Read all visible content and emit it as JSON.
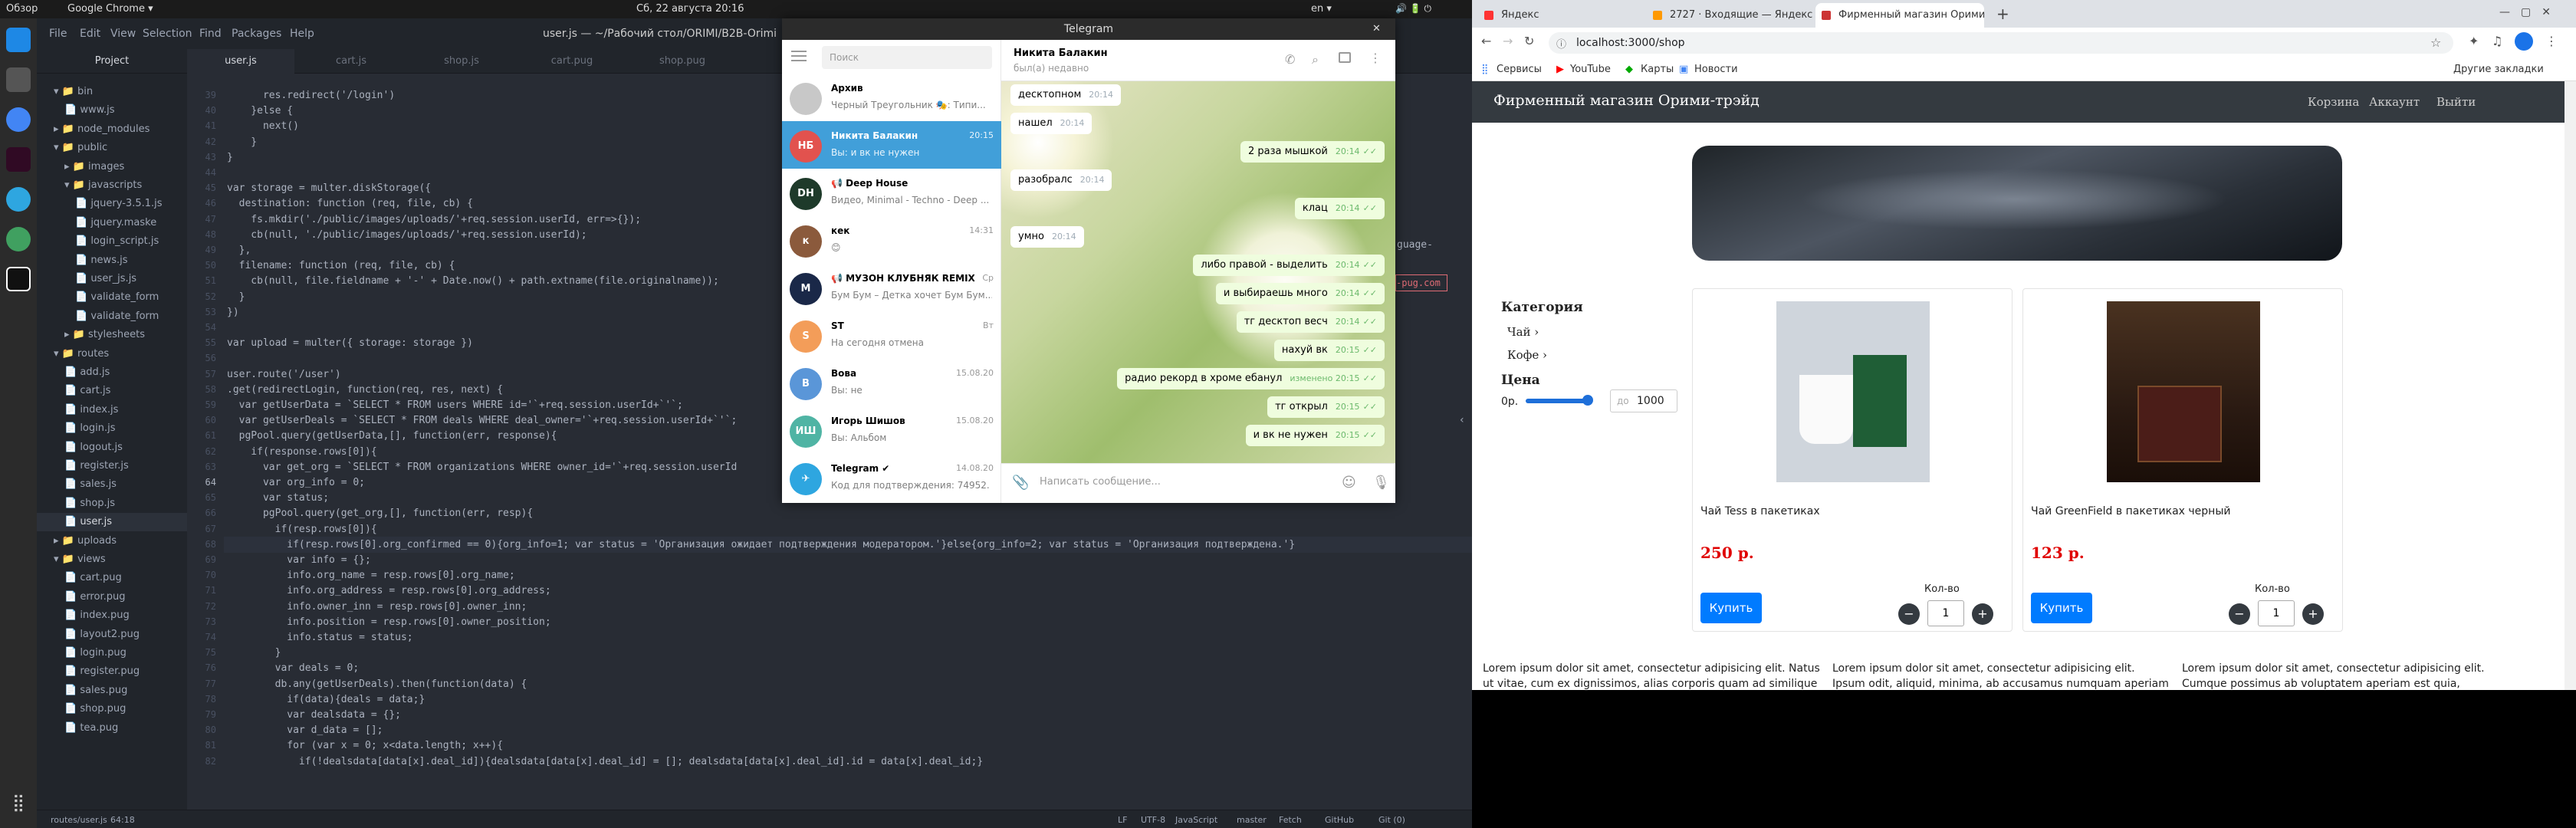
{
  "topbar": {
    "activities": "Обзор",
    "app": "Google Chrome ▾",
    "clock": "Сб, 22 августа  20:16",
    "lang": "en ▾",
    "arrow": "▾"
  },
  "atom": {
    "title": "user.js — ~/Рабочий стол/ORIMI/B2B-Orimi",
    "menu": [
      "File",
      "Edit",
      "View",
      "Selection",
      "Find",
      "Packages",
      "Help"
    ],
    "tabs": [
      "Project",
      "user.js",
      "cart.js",
      "shop.js",
      "cart.pug",
      "shop.pug"
    ],
    "tree": [
      {
        "label": "▾ 📁 bin",
        "d": 1
      },
      {
        "label": "📄 www.js",
        "d": 2
      },
      {
        "label": "▸ 📁 node_modules",
        "d": 1
      },
      {
        "label": "▾ 📁 public",
        "d": 1
      },
      {
        "label": "▸ 📁 images",
        "d": 2
      },
      {
        "label": "▾ 📁 javascripts",
        "d": 2
      },
      {
        "label": "📄 jquery-3.5.1.js",
        "d": 3
      },
      {
        "label": "📄 jquery.maske",
        "d": 3
      },
      {
        "label": "📄 login_script.js",
        "d": 3
      },
      {
        "label": "📄 news.js",
        "d": 3
      },
      {
        "label": "📄 user_js.js",
        "d": 3
      },
      {
        "label": "📄 validate_form",
        "d": 3
      },
      {
        "label": "📄 validate_form",
        "d": 3
      },
      {
        "label": "▸ 📁 stylesheets",
        "d": 2
      },
      {
        "label": "▾ 📁 routes",
        "d": 1
      },
      {
        "label": "📄 add.js",
        "d": 2
      },
      {
        "label": "📄 cart.js",
        "d": 2
      },
      {
        "label": "📄 index.js",
        "d": 2
      },
      {
        "label": "📄 login.js",
        "d": 2
      },
      {
        "label": "📄 logout.js",
        "d": 2
      },
      {
        "label": "📄 register.js",
        "d": 2
      },
      {
        "label": "📄 sales.js",
        "d": 2
      },
      {
        "label": "📄 shop.js",
        "d": 2
      },
      {
        "label": "📄 user.js",
        "d": 2
      },
      {
        "label": "▸ 📁 uploads",
        "d": 1
      },
      {
        "label": "▾ 📁 views",
        "d": 1
      },
      {
        "label": "📄 cart.pug",
        "d": 2
      },
      {
        "label": "📄 error.pug",
        "d": 2
      },
      {
        "label": "📄 index.pug",
        "d": 2
      },
      {
        "label": "📄 layout2.pug",
        "d": 2
      },
      {
        "label": "📄 login.pug",
        "d": 2
      },
      {
        "label": "📄 register.pug",
        "d": 2
      },
      {
        "label": "📄 sales.pug",
        "d": 2
      },
      {
        "label": "📄 shop.pug",
        "d": 2
      },
      {
        "label": "📄 tea.pug",
        "d": 2
      }
    ],
    "code_lines": [
      {
        "n": "39",
        "t": "      res.redirect('/login')"
      },
      {
        "n": "40",
        "t": "    }else {"
      },
      {
        "n": "41",
        "t": "      next()"
      },
      {
        "n": "42",
        "t": "    }"
      },
      {
        "n": "43",
        "t": "}"
      },
      {
        "n": "44",
        "t": ""
      },
      {
        "n": "45",
        "t": "var storage = multer.diskStorage({"
      },
      {
        "n": "46",
        "t": "  destination: function (req, file, cb) {"
      },
      {
        "n": "47",
        "t": "    fs.mkdir('./public/images/uploads/'+req.session.userId, err=>{});"
      },
      {
        "n": "48",
        "t": "    cb(null, './public/images/uploads/'+req.session.userId);"
      },
      {
        "n": "49",
        "t": "  },"
      },
      {
        "n": "50",
        "t": "  filename: function (req, file, cb) {"
      },
      {
        "n": "51",
        "t": "    cb(null, file.fieldname + '-' + Date.now() + path.extname(file.originalname));"
      },
      {
        "n": "52",
        "t": "  }"
      },
      {
        "n": "53",
        "t": "})"
      },
      {
        "n": "54",
        "t": ""
      },
      {
        "n": "55",
        "t": "var upload = multer({ storage: storage })"
      },
      {
        "n": "56",
        "t": ""
      },
      {
        "n": "57",
        "t": "user.route('/user')"
      },
      {
        "n": "58",
        "t": ".get(redirectLogin, function(req, res, next) {"
      },
      {
        "n": "59",
        "t": "  var getUserData = `SELECT * FROM users WHERE id='`+req.session.userId+`'`;"
      },
      {
        "n": "60",
        "t": "  var getUserDeals = `SELECT * FROM deals WHERE deal_owner='`+req.session.userId+`'`;"
      },
      {
        "n": "61",
        "t": "  pgPool.query(getUserData,[], function(err, response){"
      },
      {
        "n": "62",
        "t": "    if(response.rows[0]){"
      },
      {
        "n": "63",
        "t": "      var get_org = `SELECT * FROM organizations WHERE owner_id='`+req.session.userId"
      },
      {
        "n": "64",
        "t": "      var org_info = 0;"
      },
      {
        "n": "65",
        "t": "      var status;"
      },
      {
        "n": "66",
        "t": "      pgPool.query(get_org,[], function(err, resp){"
      },
      {
        "n": "67",
        "t": "        if(resp.rows[0]){"
      },
      {
        "n": "68",
        "t": "          if(resp.rows[0].org_confirmed == 0){org_info=1; var status = 'Организация ожидает подтверждения модератором.'}else{org_info=2; var status = 'Организация подтверждена.'}"
      },
      {
        "n": "69",
        "t": "          var info = {};"
      },
      {
        "n": "70",
        "t": "          info.org_name = resp.rows[0].org_name;"
      },
      {
        "n": "71",
        "t": "          info.org_address = resp.rows[0].org_address;"
      },
      {
        "n": "72",
        "t": "          info.owner_inn = resp.rows[0].owner_inn;"
      },
      {
        "n": "73",
        "t": "          info.position = resp.rows[0].owner_position;"
      },
      {
        "n": "74",
        "t": "          info.status = status;"
      },
      {
        "n": "75",
        "t": "        }"
      },
      {
        "n": "76",
        "t": "        var deals = 0;"
      },
      {
        "n": "77",
        "t": "        db.any(getUserDeals).then(function(data) {"
      },
      {
        "n": "78",
        "t": "          if(data){deals = data;}"
      },
      {
        "n": "79",
        "t": "          var dealsdata = {};"
      },
      {
        "n": "80",
        "t": "          var d_data = [];"
      },
      {
        "n": "81",
        "t": "          for (var x = 0; x<data.length; x++){"
      },
      {
        "n": "82",
        "t": "            if(!dealsdata[data[x].deal_id]){dealsdata[data[x].deal_id] = []; dealsdata[data[x].deal_id].id = data[x].deal_id;}"
      }
    ],
    "status": {
      "path": "routes/user.js",
      "pos": "64:18",
      "lf": "LF",
      "enc": "UTF-8",
      "lang": "JavaScript",
      "branch": "master",
      "fetch": "Fetch",
      "github": "GitHub",
      "git": "Git (0)"
    },
    "hint1": "guage-",
    "hint2": "-pug.com"
  },
  "telegram": {
    "title": "Telegram",
    "search_placeholder": "Поиск",
    "chats": [
      {
        "name": "Архив",
        "prev": "Черный Треугольник 🎭: Типи...",
        "time": "",
        "avatar": "",
        "color": "#c8c8c8"
      },
      {
        "name": "Никита Балакин",
        "prev": "Вы: и вк не нужен",
        "time": "20:15",
        "avatar": "НБ",
        "color": "#e2524e",
        "active": true
      },
      {
        "name": "📢 Deep House",
        "prev": "Видео, Minimal - Techno - Deep ...",
        "time": "",
        "avatar": "DH",
        "color": "#1e3a2a"
      },
      {
        "name": "кек",
        "prev": "😊",
        "time": "14:31",
        "avatar": "к",
        "color": "#8b5a3c"
      },
      {
        "name": "📢 МУЗОН КЛУБНЯК REMIX",
        "prev": "Бум Бум – Детка хочет Бум Бум...",
        "time": "Ср",
        "avatar": "M",
        "color": "#1a2848"
      },
      {
        "name": "ST",
        "prev": "На сегодня отмена",
        "time": "Вт",
        "avatar": "S",
        "color": "#f39d59"
      },
      {
        "name": "Вова",
        "prev": "Вы: не",
        "time": "15.08.20",
        "avatar": "В",
        "color": "#5a96d8"
      },
      {
        "name": "Игорь Шишов",
        "prev": "Вы: Альбом",
        "time": "15.08.20",
        "avatar": "ИШ",
        "color": "#4fb4a4"
      },
      {
        "name": "Telegram ✔",
        "prev": "Код для подтверждения: 74952. Ни...",
        "time": "14.08.20",
        "avatar": "✈",
        "color": "#2ea6e0"
      }
    ],
    "chat_name": "Никита Балакин",
    "chat_status": "был(а) недавно",
    "messages": [
      {
        "text": "десктопном",
        "time": "20:14",
        "dir": "in"
      },
      {
        "text": "нашел",
        "time": "20:14",
        "dir": "in"
      },
      {
        "text": "2 раза мышкой",
        "time": "20:14",
        "dir": "out"
      },
      {
        "text": "разобралс",
        "time": "20:14",
        "dir": "in"
      },
      {
        "text": "клац",
        "time": "20:14",
        "dir": "out"
      },
      {
        "text": "умно",
        "time": "20:14",
        "dir": "in"
      },
      {
        "text": "либо правой - выделить",
        "time": "20:14",
        "dir": "out"
      },
      {
        "text": "и выбираешь много",
        "time": "20:14",
        "dir": "out"
      },
      {
        "text": "тг десктоп весч",
        "time": "20:14",
        "dir": "out"
      },
      {
        "text": "нахуй вк",
        "time": "20:15",
        "dir": "out"
      },
      {
        "text": "радио рекорд в хроме ебанул",
        "time": "изменено 20:15",
        "dir": "out"
      },
      {
        "text": "тг открыл",
        "time": "20:15",
        "dir": "out"
      },
      {
        "text": "и вк не нужен",
        "time": "20:15",
        "dir": "out"
      }
    ],
    "input_placeholder": "Написать сообщение..."
  },
  "chrome": {
    "tabs": [
      "Яндекс",
      "2727 · Входящие — Яндекс",
      "Фирменный магазин Орими",
      "+"
    ],
    "url": "localhost:3000/shop",
    "bookmarks": [
      "Сервисы",
      "YouTube",
      "Карты",
      "Новости"
    ],
    "other_bookmarks": "Другие закладки",
    "shop": {
      "brand": "Фирменный магазин Орими-трэйд",
      "nav": [
        "Корзина",
        "Аккаунт",
        "Выйти"
      ],
      "category_title": "Категория",
      "categories": [
        "Чай ›",
        "Кофе ›"
      ],
      "price_title": "Цена",
      "price_min_label": "0р.",
      "price_to": "до",
      "price_max": "1000",
      "products": [
        {
          "name": "Чай Tess в пакетиках",
          "price": "250 р.",
          "buy": "Купить",
          "qty_label": "Кол-во",
          "qty": "1"
        },
        {
          "name": "Чай GreenField в пакетиках черный",
          "price": "123 р.",
          "buy": "Купить",
          "qty_label": "Кол-во",
          "qty": "1"
        }
      ],
      "lorem": [
        "Lorem ipsum dolor sit amet, consectetur adipisicing elit. Natus ut vitae, cum ex dignissimos, alias corporis quam ad similique",
        "Lorem ipsum dolor sit amet, consectetur adipisicing elit. Ipsum odit, aliquid, minima, ab accusamus numquam aperiam",
        "Lorem ipsum dolor sit amet, consectetur adipisicing elit. Cumque possimus ab voluptatem aperiam est quia,"
      ]
    }
  },
  "colors": {
    "atom_bg": "#282c34",
    "telegram_accent": "#419fd9",
    "shop_nav": "#343a40",
    "buy_button": "#007bff",
    "price": "#e00000"
  }
}
